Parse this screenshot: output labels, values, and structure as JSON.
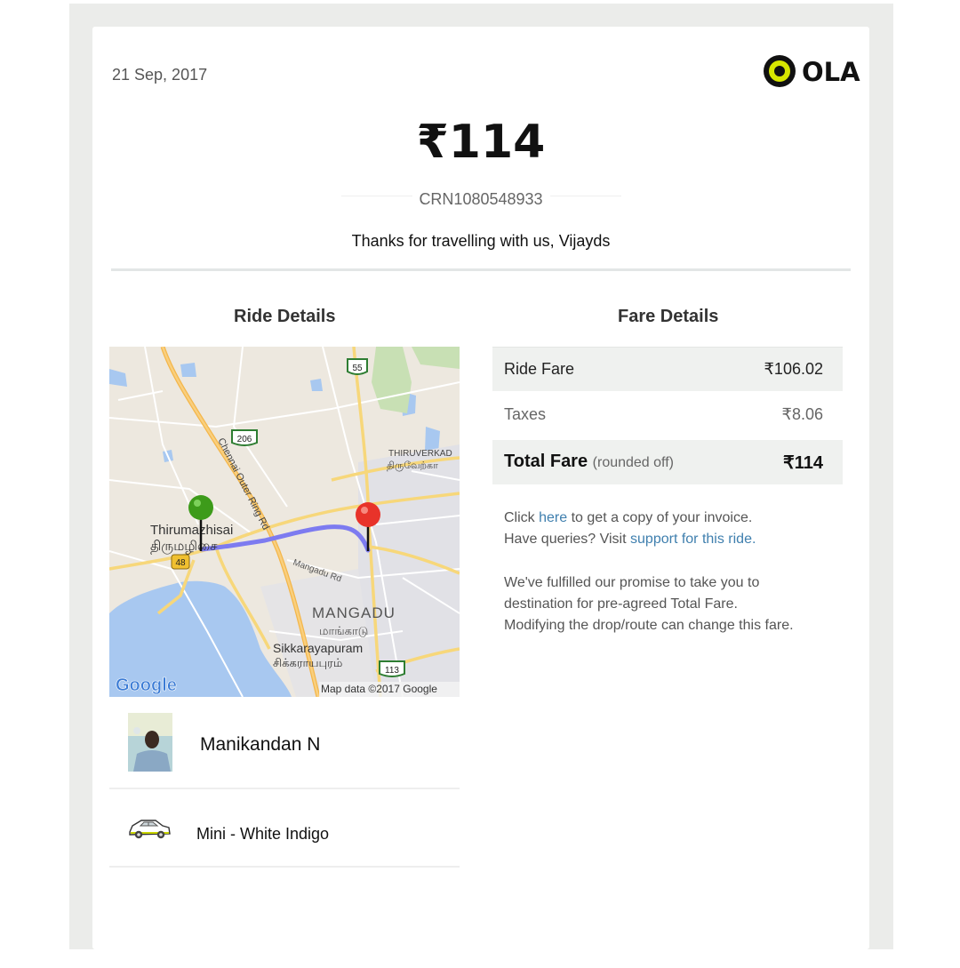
{
  "header": {
    "date": "21 Sep, 2017",
    "logo_text": "OLA"
  },
  "summary": {
    "amount": "₹114",
    "crn": "CRN1080548933",
    "thanks": "Thanks for travelling with us, Vijayds"
  },
  "ride": {
    "title": "Ride Details",
    "map": {
      "labels": {
        "town1_en": "Thirumazhisai",
        "town1_ta": "திருமழிசை",
        "town2_en": "MANGADU",
        "town2_ta": "மாங்காடு",
        "town3_en": "Sikkarayapuram",
        "town3_ta": "சிக்கராயபுரம்",
        "town4_en": "THIRUVERKAD",
        "town4_ta": "திருவேற்கா",
        "road1": "Chennai Outer Ring Rd",
        "road2": "Mangadu Rd",
        "shield1": "55",
        "shield2": "206",
        "shield3": "48",
        "shield4": "113",
        "attribution": "Map data ©2017 Google",
        "google": "Google"
      }
    },
    "driver_name": "Manikandan N",
    "car": "Mini - White Indigo"
  },
  "fare": {
    "title": "Fare Details",
    "rows": [
      {
        "label": "Ride Fare",
        "value": "₹106.02"
      },
      {
        "label": "Taxes",
        "value": "₹8.06"
      }
    ],
    "total_label": "Total Fare",
    "total_note": "(rounded off)",
    "total_value": "₹114"
  },
  "notes": {
    "click": "Click",
    "here_link": "here",
    "invoice": "to get a copy of your invoice.",
    "queries": "Have queries? Visit",
    "support_link": "support for this ride.",
    "promise_1": "We've fulfilled our promise to take you to",
    "promise_2": "destination for pre-agreed Total Fare.",
    "promise_3": "Modifying the drop/route can change this fare."
  },
  "colors": {
    "link": "#3f7fae",
    "route": "#7d7bf0",
    "pin_start": "#3d9b1a",
    "pin_end": "#e8332a",
    "logo_yellow": "#d7e600"
  }
}
